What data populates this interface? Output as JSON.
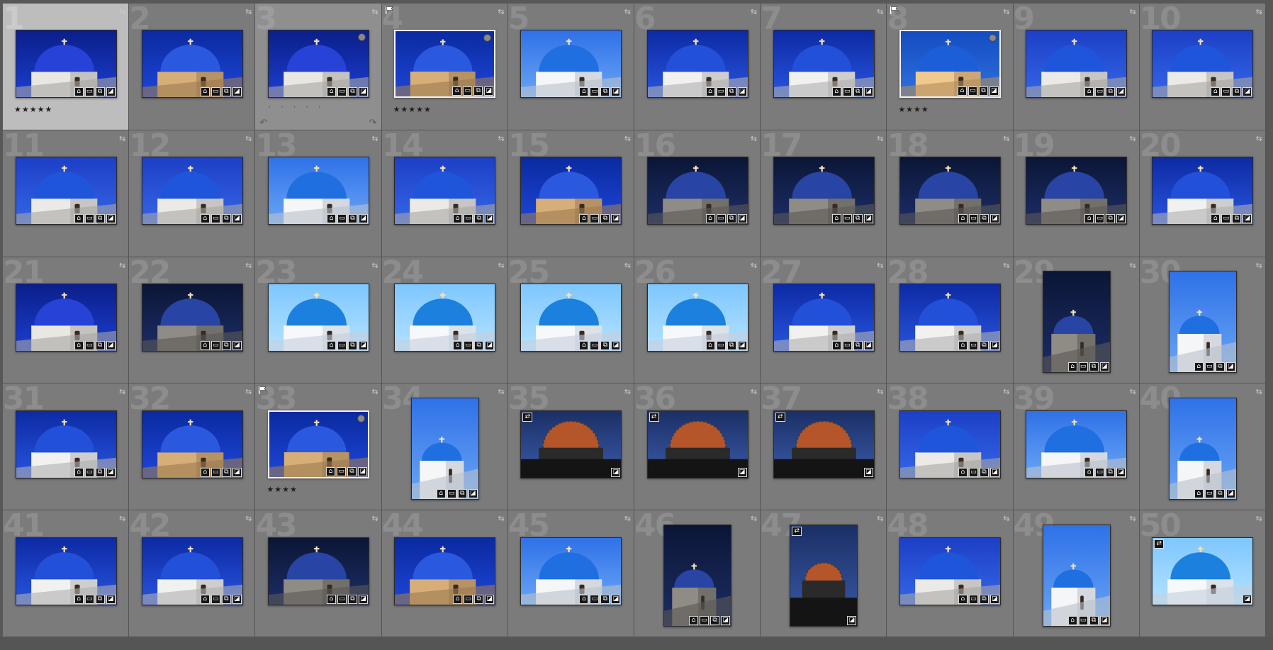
{
  "grid": {
    "cells": [
      {
        "number": "1",
        "rating": "★★★★★",
        "selected": true,
        "thumb": {
          "orientation": "landscape",
          "palette": "deepblue",
          "has_badges": true
        }
      },
      {
        "number": "2",
        "thumb": {
          "orientation": "landscape",
          "palette": "tan",
          "has_badges": true
        }
      },
      {
        "number": "3",
        "rating": "· · · · ·",
        "alt": true,
        "thumb": {
          "orientation": "landscape",
          "palette": "deepblue",
          "has_dot": true,
          "has_badges": true
        }
      },
      {
        "number": "4",
        "rating": "★★★★★",
        "flagged": true,
        "thumb": {
          "orientation": "landscape",
          "palette": "tan",
          "has_dot": true,
          "highlight": true,
          "has_badges": true
        }
      },
      {
        "number": "5",
        "thumb": {
          "orientation": "landscape",
          "palette": "bright",
          "has_badges": true
        }
      },
      {
        "number": "6",
        "thumb": {
          "orientation": "landscape",
          "palette": "twin",
          "has_badges": true
        }
      },
      {
        "number": "7",
        "thumb": {
          "orientation": "landscape",
          "palette": "twin",
          "has_badges": true
        }
      },
      {
        "number": "8",
        "rating": "★★★★",
        "flagged": true,
        "thumb": {
          "orientation": "landscape",
          "palette": "corner",
          "has_dot": true,
          "highlight": true,
          "has_badges": true
        }
      },
      {
        "number": "9",
        "thumb": {
          "orientation": "landscape",
          "palette": "blue",
          "has_badges": true
        }
      },
      {
        "number": "10",
        "thumb": {
          "orientation": "landscape",
          "palette": "blue",
          "has_badges": true
        }
      },
      {
        "number": "11",
        "thumb": {
          "orientation": "landscape",
          "palette": "blue",
          "has_badges": true
        }
      },
      {
        "number": "12",
        "thumb": {
          "orientation": "landscape",
          "palette": "blue",
          "has_badges": true
        }
      },
      {
        "number": "13",
        "thumb": {
          "orientation": "landscape",
          "palette": "bright",
          "has_badges": true
        }
      },
      {
        "number": "14",
        "thumb": {
          "orientation": "landscape",
          "palette": "blue",
          "has_badges": true
        }
      },
      {
        "number": "15",
        "thumb": {
          "orientation": "landscape",
          "palette": "tan",
          "has_badges": true
        }
      },
      {
        "number": "16",
        "thumb": {
          "orientation": "landscape",
          "palette": "night",
          "has_badges": true
        }
      },
      {
        "number": "17",
        "thumb": {
          "orientation": "landscape",
          "palette": "night",
          "has_badges": true
        }
      },
      {
        "number": "18",
        "thumb": {
          "orientation": "landscape",
          "palette": "night",
          "has_badges": true
        }
      },
      {
        "number": "19",
        "thumb": {
          "orientation": "landscape",
          "palette": "night",
          "has_badges": true
        }
      },
      {
        "number": "20",
        "thumb": {
          "orientation": "landscape",
          "palette": "twin",
          "has_badges": true
        }
      },
      {
        "number": "21",
        "thumb": {
          "orientation": "landscape",
          "palette": "deepblue",
          "has_badges": true
        }
      },
      {
        "number": "22",
        "thumb": {
          "orientation": "landscape",
          "palette": "night",
          "has_badges": true
        }
      },
      {
        "number": "23",
        "thumb": {
          "orientation": "landscape",
          "palette": "sky",
          "has_badges": true
        }
      },
      {
        "number": "24",
        "thumb": {
          "orientation": "landscape",
          "palette": "sky",
          "has_badges": true
        }
      },
      {
        "number": "25",
        "thumb": {
          "orientation": "landscape",
          "palette": "sky",
          "has_badges": true
        }
      },
      {
        "number": "26",
        "thumb": {
          "orientation": "landscape",
          "palette": "sky",
          "has_badges": true
        }
      },
      {
        "number": "27",
        "thumb": {
          "orientation": "landscape",
          "palette": "twin",
          "has_badges": true
        }
      },
      {
        "number": "28",
        "thumb": {
          "orientation": "landscape",
          "palette": "twin",
          "has_badges": true
        }
      },
      {
        "number": "29",
        "thumb": {
          "orientation": "portrait",
          "palette": "night",
          "has_badges": true
        }
      },
      {
        "number": "30",
        "thumb": {
          "orientation": "portrait",
          "palette": "bright",
          "has_badges": true
        }
      },
      {
        "number": "31",
        "thumb": {
          "orientation": "landscape",
          "palette": "twin",
          "has_badges": true
        }
      },
      {
        "number": "32",
        "thumb": {
          "orientation": "landscape",
          "palette": "tan",
          "has_badges": true
        }
      },
      {
        "number": "33",
        "rating": "★★★★",
        "flagged": true,
        "thumb": {
          "orientation": "landscape",
          "palette": "tan",
          "has_dot": true,
          "highlight": true,
          "has_badges": true
        }
      },
      {
        "number": "34",
        "thumb": {
          "orientation": "portrait",
          "palette": "bright",
          "has_badges": true
        }
      },
      {
        "number": "35",
        "thumb": {
          "orientation": "landscape",
          "palette": "orange",
          "virtual_copy": true,
          "has_badges": true
        }
      },
      {
        "number": "36",
        "thumb": {
          "orientation": "landscape",
          "palette": "orange",
          "virtual_copy": true,
          "has_badges": true
        }
      },
      {
        "number": "37",
        "thumb": {
          "orientation": "landscape",
          "palette": "orange",
          "virtual_copy": true,
          "has_badges": true
        }
      },
      {
        "number": "38",
        "thumb": {
          "orientation": "landscape",
          "palette": "blue",
          "has_badges": true
        }
      },
      {
        "number": "39",
        "thumb": {
          "orientation": "landscape",
          "palette": "bright",
          "has_badges": true
        }
      },
      {
        "number": "40",
        "thumb": {
          "orientation": "portrait",
          "palette": "bright",
          "has_badges": true
        }
      },
      {
        "number": "41",
        "thumb": {
          "orientation": "landscape",
          "palette": "twin",
          "has_badges": true
        }
      },
      {
        "number": "42",
        "thumb": {
          "orientation": "landscape",
          "palette": "twin",
          "has_badges": true
        }
      },
      {
        "number": "43",
        "thumb": {
          "orientation": "landscape",
          "palette": "night",
          "has_badges": true
        }
      },
      {
        "number": "44",
        "thumb": {
          "orientation": "landscape",
          "palette": "tan",
          "has_badges": true
        }
      },
      {
        "number": "45",
        "thumb": {
          "orientation": "landscape",
          "palette": "bright",
          "has_badges": true
        }
      },
      {
        "number": "46",
        "thumb": {
          "orientation": "portrait",
          "palette": "night",
          "has_badges": true
        }
      },
      {
        "number": "47",
        "thumb": {
          "orientation": "portrait",
          "palette": "orange",
          "virtual_copy": true,
          "has_badges": true
        }
      },
      {
        "number": "48",
        "thumb": {
          "orientation": "landscape",
          "palette": "blue",
          "has_badges": true
        }
      },
      {
        "number": "49",
        "thumb": {
          "orientation": "portrait",
          "palette": "bright",
          "has_badges": true
        }
      },
      {
        "number": "50",
        "thumb": {
          "orientation": "landscape",
          "palette": "sky",
          "virtual_copy": true,
          "has_badges": true
        }
      }
    ]
  },
  "colors": {
    "cell_background": "#7b7b7b",
    "cell_selected": "#bdbdbd",
    "app_background": "#585858"
  }
}
